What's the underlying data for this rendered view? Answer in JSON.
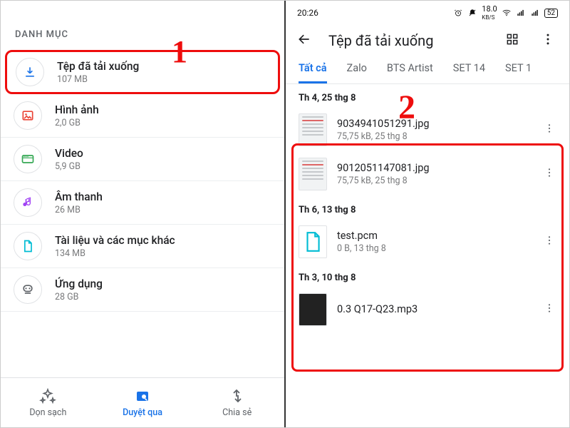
{
  "left": {
    "section_header": "DANH MỤC",
    "categories": [
      {
        "title": "Tệp đã tải xuống",
        "subtitle": "107 MB",
        "icon": "download",
        "color": "#1a73e8",
        "highlight": true
      },
      {
        "title": "Hình ảnh",
        "subtitle": "2,0 GB",
        "icon": "image",
        "color": "#ea4335"
      },
      {
        "title": "Video",
        "subtitle": "5,9 GB",
        "icon": "video",
        "color": "#34a853"
      },
      {
        "title": "Âm thanh",
        "subtitle": "26 MB",
        "icon": "audio",
        "color": "#a142f4"
      },
      {
        "title": "Tài liệu và các mục khác",
        "subtitle": "134 MB",
        "icon": "doc",
        "color": "#00bcd4"
      },
      {
        "title": "Ứng dụng",
        "subtitle": "28 GB",
        "icon": "app",
        "color": "#5f6368"
      }
    ],
    "nav": {
      "clean": "Dọn sạch",
      "browse": "Duyệt qua",
      "share": "Chia sẻ"
    }
  },
  "right": {
    "status_time": "20:26",
    "status_net": "18.0",
    "status_net_unit": "KB/S",
    "status_batt": "52",
    "title": "Tệp đã tải xuống",
    "tabs": [
      "Tất cả",
      "Zalo",
      "BTS Artist",
      "SET 14",
      "SET 1"
    ],
    "groups": [
      {
        "date": "Th 4, 25 thg 8",
        "files": [
          {
            "name": "9034941051291.jpg",
            "meta": "75,75 kB, 25 thg 8",
            "thumb": "img"
          },
          {
            "name": "9012051147081.jpg",
            "meta": "75,75 kB, 25 thg 8",
            "thumb": "img"
          }
        ]
      },
      {
        "date": "Th 6, 13 thg 8",
        "files": [
          {
            "name": "test.pcm",
            "meta": "0 B, 13 thg 8",
            "thumb": "doc"
          }
        ]
      },
      {
        "date": "Th 3, 10 thg 8",
        "files": [
          {
            "name": "0.3 Q17-Q23.mp3",
            "meta": "",
            "thumb": "dark"
          }
        ]
      }
    ]
  },
  "annotations": {
    "one": "1",
    "two": "2"
  }
}
